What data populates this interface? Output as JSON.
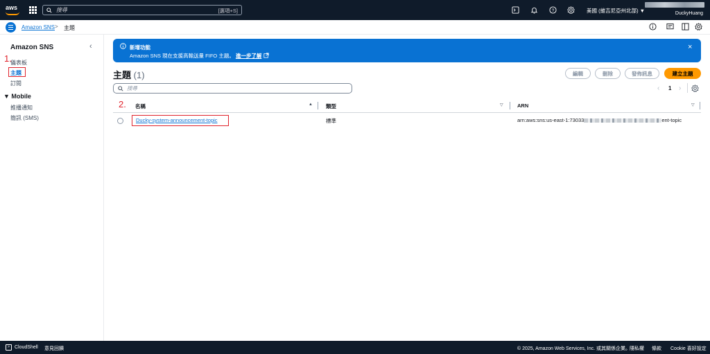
{
  "topnav": {
    "logo_text": "aws",
    "search_placeholder": "搜尋",
    "search_shortcut": "[選項+S]",
    "region": "美國 (維吉尼亞州北部) ▼",
    "account_name": "DuckyHuang"
  },
  "breadcrumb": {
    "service": "Amazon SNS",
    "separator": ">",
    "current": "主題"
  },
  "sidebar": {
    "title": "Amazon SNS",
    "close": "‹",
    "items": [
      {
        "label": "儀表板"
      },
      {
        "label": "主題"
      },
      {
        "label": "訂閱"
      }
    ],
    "section": "Mobile",
    "section_items": [
      {
        "label": "推播通知"
      },
      {
        "label": "簡訊 (SMS)"
      }
    ]
  },
  "annotations": {
    "step1": "1.",
    "step2": "2."
  },
  "flash": {
    "title": "新增功能",
    "body": "Amazon SNS 現在支援高輸送量 FIFO 主題。",
    "link": "進一步了解",
    "close": "×"
  },
  "page": {
    "title": "主題",
    "count": "(1)"
  },
  "buttons": {
    "edit": "編輯",
    "delete": "刪除",
    "publish": "發佈訊息",
    "create": "建立主題"
  },
  "filter": {
    "placeholder": "搜尋"
  },
  "pagination": {
    "prev": "‹",
    "page": "1",
    "next": "›"
  },
  "table": {
    "columns": [
      {
        "label": "名稱",
        "sort": "▲"
      },
      {
        "label": "類型",
        "sort": "▽"
      },
      {
        "label": "ARN",
        "sort": "▽"
      }
    ],
    "rows": [
      {
        "name": "Ducky-system-announcement-topic",
        "type": "標準",
        "arn_prefix": "arn:aws:sns:us-east-1:73033",
        "arn_suffix": "ent-topic"
      }
    ]
  },
  "footer": {
    "cloudshell": "CloudShell",
    "feedback": "意見回饋",
    "copyright": "© 2025, Amazon Web Services, Inc. 或其關係企業。",
    "privacy": "隱私權",
    "terms": "條款",
    "cookie": "Cookie 喜好設定"
  },
  "colors": {
    "nav_bg": "#0f1b2a",
    "accent_blue": "#0972d3",
    "primary_orange": "#ff9900",
    "annotation_red": "#e0222b"
  }
}
